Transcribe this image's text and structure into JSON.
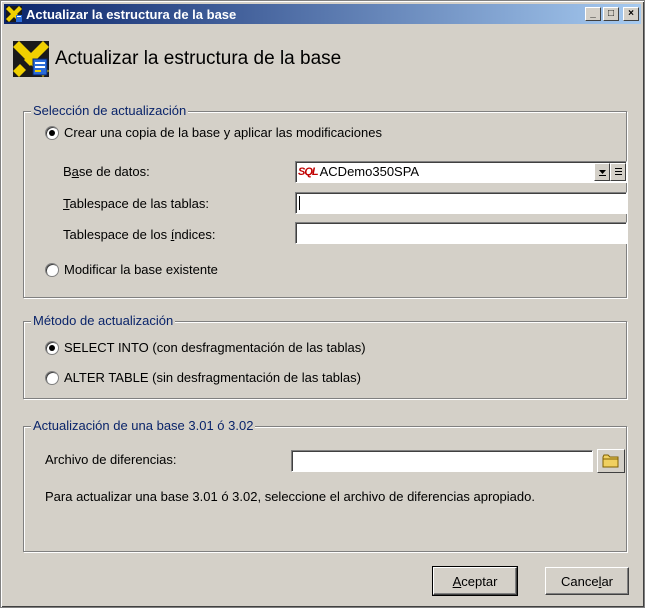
{
  "window": {
    "title": "Actualizar la estructura de la base",
    "minimize_glyph": "_",
    "maximize_glyph": "□",
    "close_glyph": "×"
  },
  "header": {
    "title": "Actualizar la estructura de la base"
  },
  "selection_group": {
    "legend": "Selección de actualización",
    "option_copy": "Crear una copia de la base y aplicar las modificaciones",
    "option_copy_selected": true,
    "database_label": {
      "prefix": "B",
      "underlined": "a",
      "rest": "se de datos:"
    },
    "database_value": "ACDemo350SPA",
    "database_badge": "SQL",
    "tables_label": {
      "underlined": "T",
      "rest": "ablespace de las tablas:"
    },
    "tables_value": "",
    "indexes_label": {
      "prefix": "Tablespace de los ",
      "underlined": "í",
      "rest": "ndices:"
    },
    "indexes_value": "",
    "option_modify": "Modificar la base existente"
  },
  "method_group": {
    "legend": "Método de actualización",
    "option_select_into": "SELECT INTO (con desfragmentación de las tablas)",
    "option_alter_table": "ALTER TABLE (sin desfragmentación de las tablas)",
    "selected": "select_into"
  },
  "legacy_group": {
    "legend": "Actualización de una base 3.01 ó 3.02",
    "diff_file_label": "Archivo de diferencias:",
    "diff_file_value": "",
    "help_text": "Para actualizar una base 3.01 ó 3.02, seleccione el archivo de diferencias apropiado."
  },
  "buttons": {
    "accept": {
      "underlined": "A",
      "rest": "ceptar"
    },
    "cancel": {
      "prefix": "Cance",
      "underlined": "l",
      "rest": "ar"
    }
  },
  "icons": {
    "title": "database-upgrade-icon",
    "header": "database-upgrade-icon",
    "folder": "folder-icon",
    "combo_arrow": "chevron-down-icon",
    "combo_list": "list-icon"
  }
}
